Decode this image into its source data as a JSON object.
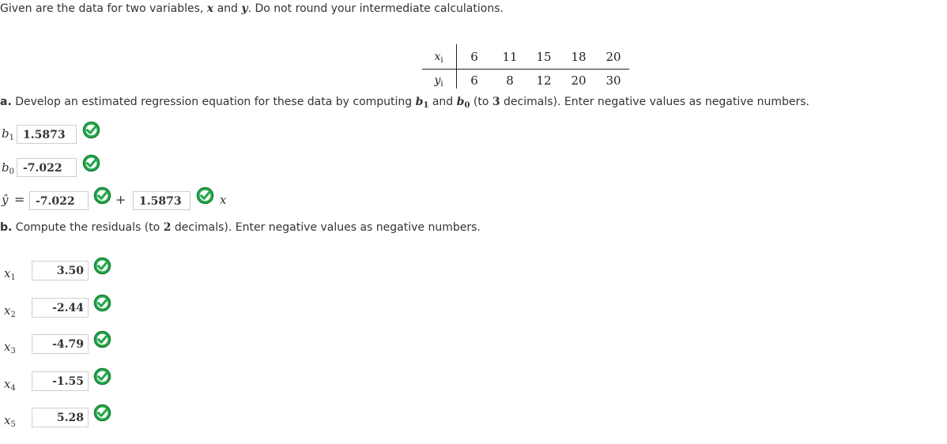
{
  "intro": {
    "part1": "Given are the data for two variables, ",
    "x": "x",
    "and": " and ",
    "y": "y",
    "part2": ". Do not round your intermediate calculations."
  },
  "table": {
    "x_label": "x",
    "x_sub": "i",
    "y_label": "y",
    "y_sub": "i",
    "x_values": [
      "6",
      "11",
      "15",
      "18",
      "20"
    ],
    "y_values": [
      "6",
      "8",
      "12",
      "20",
      "30"
    ]
  },
  "part_a": {
    "letter": "a.",
    "text1": " Develop an estimated regression equation for these data by computing ",
    "b1": "b",
    "b1_sub": "1",
    "and": " and ",
    "b0": "b",
    "b0_sub": "0",
    "text2": " (to ",
    "decimals": "3",
    "text3": " decimals). Enter negative values as negative numbers.",
    "b1_label": "b",
    "b1_label_sub": "1",
    "b1_value": "1.5873",
    "b0_label": "b",
    "b0_label_sub": "0",
    "b0_value": "-7.022",
    "yhat": "ŷ",
    "equals": "=",
    "eq_intercept": "-7.022",
    "plus": "+",
    "eq_slope": "1.5873",
    "eq_x": "x"
  },
  "part_b": {
    "letter": "b.",
    "text1": " Compute the residuals (to ",
    "decimals": "2",
    "text2": " decimals). Enter negative values as negative numbers.",
    "residuals": [
      {
        "label": "x",
        "sub": "1",
        "value": "3.50"
      },
      {
        "label": "x",
        "sub": "2",
        "value": "-2.44"
      },
      {
        "label": "x",
        "sub": "3",
        "value": "-4.79"
      },
      {
        "label": "x",
        "sub": "4",
        "value": "-1.55"
      },
      {
        "label": "x",
        "sub": "5",
        "value": "5.28"
      }
    ]
  },
  "colors": {
    "check_fill": "#22a84a",
    "check_border": "#1b7f37",
    "text": "#333333"
  },
  "icons": {
    "correct": "check-circle-icon"
  }
}
